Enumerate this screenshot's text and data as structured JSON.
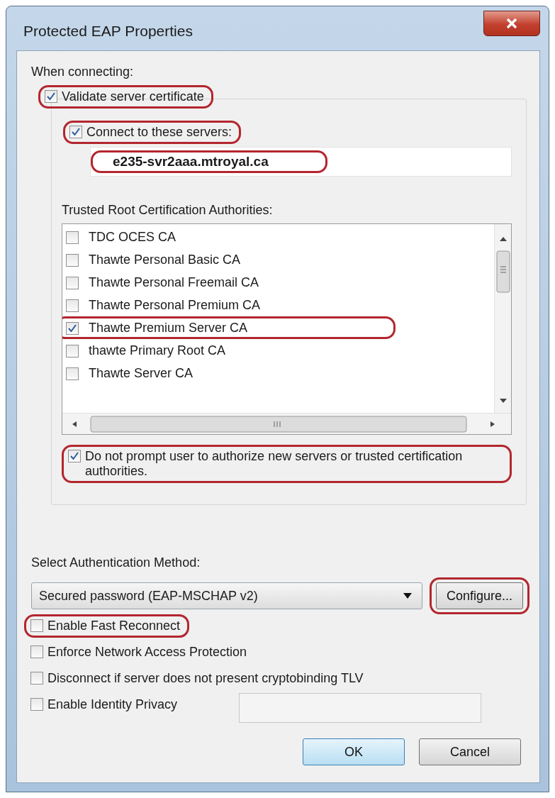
{
  "window": {
    "title": "Protected EAP Properties"
  },
  "when_connecting": {
    "label": "When connecting:",
    "validate": {
      "label": "Validate server certificate",
      "checked": true,
      "highlighted": true
    }
  },
  "servers": {
    "connect": {
      "label": "Connect to these servers:",
      "checked": true,
      "highlighted": true
    },
    "field": {
      "value": "e235-svr2aaa.mtroyal.ca",
      "highlighted": true
    }
  },
  "trusted_roots": {
    "label": "Trusted Root Certification Authorities:",
    "items": [
      {
        "label": "TDC OCES CA",
        "checked": false,
        "highlighted": false
      },
      {
        "label": "Thawte Personal Basic CA",
        "checked": false,
        "highlighted": false
      },
      {
        "label": "Thawte Personal Freemail CA",
        "checked": false,
        "highlighted": false
      },
      {
        "label": "Thawte Personal Premium CA",
        "checked": false,
        "highlighted": false
      },
      {
        "label": "Thawte Premium Server CA",
        "checked": true,
        "highlighted": true
      },
      {
        "label": "thawte Primary Root CA",
        "checked": false,
        "highlighted": false
      },
      {
        "label": "Thawte Server CA",
        "checked": false,
        "highlighted": false
      }
    ]
  },
  "do_not_prompt": {
    "label": "Do not prompt user to authorize new servers or trusted certification authorities.",
    "checked": true,
    "highlighted": true
  },
  "auth_method": {
    "label": "Select Authentication Method:",
    "value": "Secured password (EAP-MSCHAP v2)",
    "configure": {
      "label": "Configure...",
      "highlighted": true
    }
  },
  "options": [
    {
      "label": "Enable Fast Reconnect",
      "checked": false,
      "highlighted": true
    },
    {
      "label": "Enforce Network Access Protection",
      "checked": false,
      "highlighted": false
    },
    {
      "label": "Disconnect if server does not present cryptobinding TLV",
      "checked": false,
      "highlighted": false
    },
    {
      "label": "Enable Identity Privacy",
      "checked": false,
      "highlighted": false
    }
  ],
  "buttons": [
    {
      "label": "OK",
      "default": true
    },
    {
      "label": "Cancel",
      "default": false
    }
  ]
}
